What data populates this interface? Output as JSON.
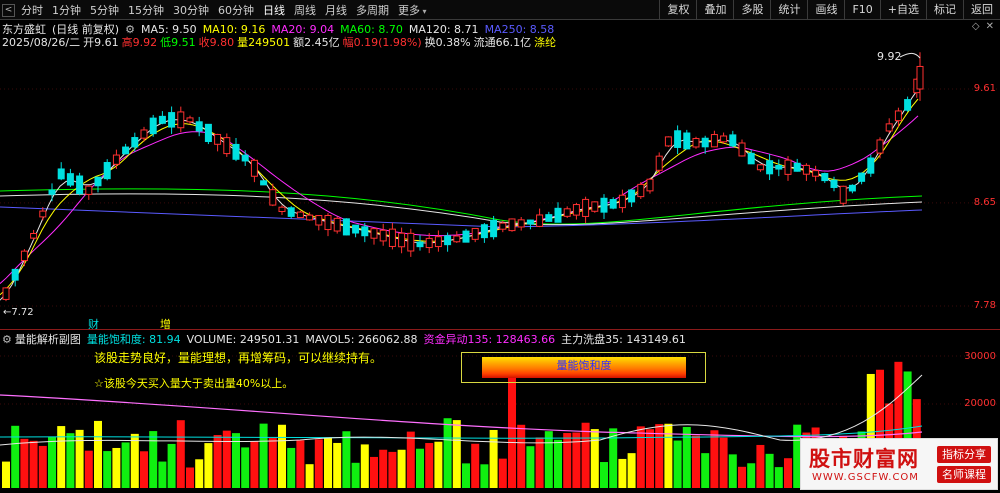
{
  "toolbar": {
    "back_glyph": "<",
    "tabs": [
      {
        "label": "分时"
      },
      {
        "label": "1分钟"
      },
      {
        "label": "5分钟"
      },
      {
        "label": "15分钟"
      },
      {
        "label": "30分钟"
      },
      {
        "label": "60分钟"
      },
      {
        "label": "日线"
      },
      {
        "label": "周线"
      },
      {
        "label": "月线"
      },
      {
        "label": "多周期"
      },
      {
        "label": "更多"
      }
    ],
    "active_tab": "日线",
    "right_buttons": [
      {
        "label": "复权"
      },
      {
        "label": "叠加"
      },
      {
        "label": "多股"
      },
      {
        "label": "统计"
      },
      {
        "label": "画线"
      },
      {
        "label": "F10"
      },
      {
        "label": "+自选"
      },
      {
        "label": "标记"
      },
      {
        "label": "返回"
      }
    ]
  },
  "header": {
    "stock_name": "东方盛虹",
    "mode": "(日线 前复权)",
    "ma_legend": [
      {
        "label": "MA5: 9.50",
        "color": "#e6e6e6"
      },
      {
        "label": "MA10: 9.16",
        "color": "#ffff00"
      },
      {
        "label": "MA20: 9.04",
        "color": "#ff2cff"
      },
      {
        "label": "MA60: 8.70",
        "color": "#00ff00"
      },
      {
        "label": "MA120: 8.71",
        "color": "#e6e6e6"
      },
      {
        "label": "MA250: 8.58",
        "color": "#5a5aff"
      }
    ],
    "quote": {
      "date": "2025/08/26/二",
      "open": "开9.61",
      "high": "高9.92",
      "low": "低9.51",
      "close": "收9.80",
      "volume": "量249501",
      "amount": "额2.45亿",
      "change": "幅0.19(1.98%)",
      "turnover": "换0.38%",
      "float": "流通66.1亿",
      "concept": "涤纶"
    }
  },
  "price_axis": {
    "labels": [
      {
        "value": "9.61"
      },
      {
        "value": "8.65"
      },
      {
        "value": "7.78"
      }
    ],
    "high_marker": "9.92",
    "low_marker": "←7.72"
  },
  "event_markers": [
    {
      "label": "财"
    },
    {
      "label": "增"
    }
  ],
  "indicator": {
    "title": "量能解析副图",
    "values": [
      {
        "label": "量能饱和度: 81.94",
        "color": "#00e0e0"
      },
      {
        "label": "VOLUME: 249501.31",
        "color": "#e6e6e6"
      },
      {
        "label": "MAVOL5: 266062.88",
        "color": "#e6e6e6"
      },
      {
        "label": "资金异动135: 128463.66",
        "color": "#ff2cff"
      },
      {
        "label": "主力洗盘35: 143149.61",
        "color": "#e6e6e6"
      }
    ],
    "message1": "该股走势良好，量能理想，再增筹码，可以继续持有。",
    "message2": "☆该股今天买入量大于卖出量40%以上。",
    "saturation_label": "量能饱和度",
    "saturation_level": 0.82,
    "axis_labels": [
      {
        "value": "30000"
      },
      {
        "value": "20000"
      }
    ]
  },
  "watermark": {
    "title": "股市财富网",
    "url": "WWW.GSCFW.COM",
    "button1": "指标分享",
    "button2": "名师课程"
  },
  "chart_data": {
    "type": "candlestick",
    "title": "东方盛虹 (日线 前复权)",
    "y_range": [
      7.7,
      10.0
    ],
    "price_ticks": [
      9.61,
      8.65,
      7.78
    ],
    "colors": {
      "up": "#ff3030",
      "down": "#00e0e0",
      "ma5": "#e6e6e6",
      "ma10": "#ffff00",
      "ma20": "#ff2cff",
      "ma60": "#00ff00",
      "ma120": "#e6e6e6",
      "ma250": "#5a5aff"
    },
    "high": 9.92,
    "low": 7.72,
    "last": {
      "open": 9.61,
      "high": 9.92,
      "low": 9.51,
      "close": 9.8
    },
    "ma_values": {
      "MA5": 9.5,
      "MA10": 9.16,
      "MA20": 9.04,
      "MA60": 8.7,
      "MA120": 8.71,
      "MA250": 8.58
    },
    "volume_series": {
      "VOLUME": 249501.31,
      "MAVOL5": 266062.88,
      "资金异动135": 128463.66,
      "主力洗盘35": 143149.61
    },
    "volume_ticks": [
      30000,
      20000
    ]
  }
}
